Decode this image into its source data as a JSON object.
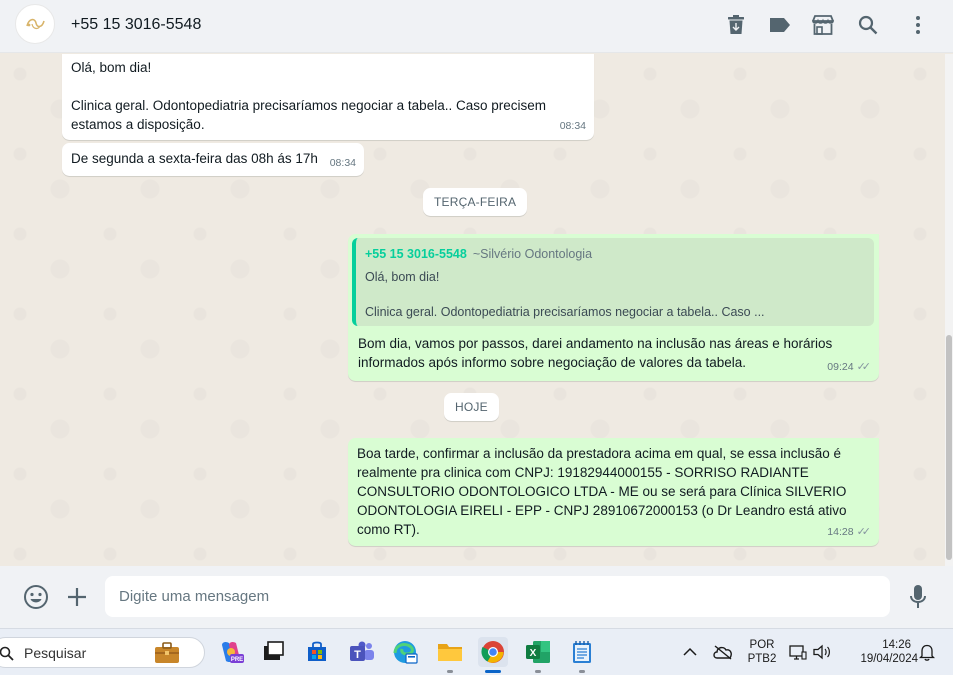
{
  "header": {
    "contact": "+55 15 3016-5548",
    "icons": [
      "delete-icon",
      "label-icon",
      "shop-icon",
      "search-icon",
      "menu-icon"
    ]
  },
  "messages": {
    "m1": {
      "line1": "Olá, bom dia!",
      "line2": "Clinica geral. Odontopediatria precisaríamos negociar a tabela.. Caso precisem",
      "line3": "estamos a disposição.",
      "time": "08:34"
    },
    "m2": {
      "text": "De segunda a sexta-feira das 08h ás 17h",
      "time": "08:34"
    },
    "date1": "TERÇA-FEIRA",
    "m3": {
      "quote_author": "+55 15 3016-5548",
      "quote_pushname": "~Silvério Odontologia",
      "quote_line1": "Olá, bom dia!",
      "quote_line2": "Clinica geral. Odontopediatria precisaríamos negociar a tabela.. Caso ...",
      "line1": "Bom dia, vamos por passos, darei andamento na inclusão nas áreas e horários",
      "line2": "informados após informo sobre negociação de valores da tabela.",
      "time": "09:24"
    },
    "date2": "HOJE",
    "m4": {
      "line1": "Boa tarde, confirmar a inclusão da prestadora acima em qual, se essa inclusão é",
      "line2": "realmente pra clinica com CNPJ: 19182944000155 -  SORRISO RADIANTE",
      "line3": "CONSULTORIO ODONTOLOGICO LTDA - ME ou se será para Clínica SILVERIO",
      "line4": "ODONTOLOGIA EIRELI - EPP - CNPJ 28910672000153 (o Dr Leandro está ativo",
      "line5": "como RT).",
      "time": "14:28"
    }
  },
  "composer": {
    "placeholder": "Digite uma mensagem"
  },
  "taskbar": {
    "search_label": "Pesquisar",
    "apps": [
      "briefcase",
      "copilot",
      "task-view",
      "store",
      "teams",
      "edge",
      "file-explorer",
      "chrome",
      "excel",
      "notepad"
    ],
    "lang_line1": "POR",
    "lang_line2": "PTB2",
    "clock_time": "14:26",
    "clock_date": "19/04/2024"
  },
  "colors": {
    "outgoing_bubble": "#d9fdd3",
    "incoming_bubble": "#ffffff",
    "chat_bg": "#efeae2",
    "quote_accent": "#06cf9c"
  }
}
